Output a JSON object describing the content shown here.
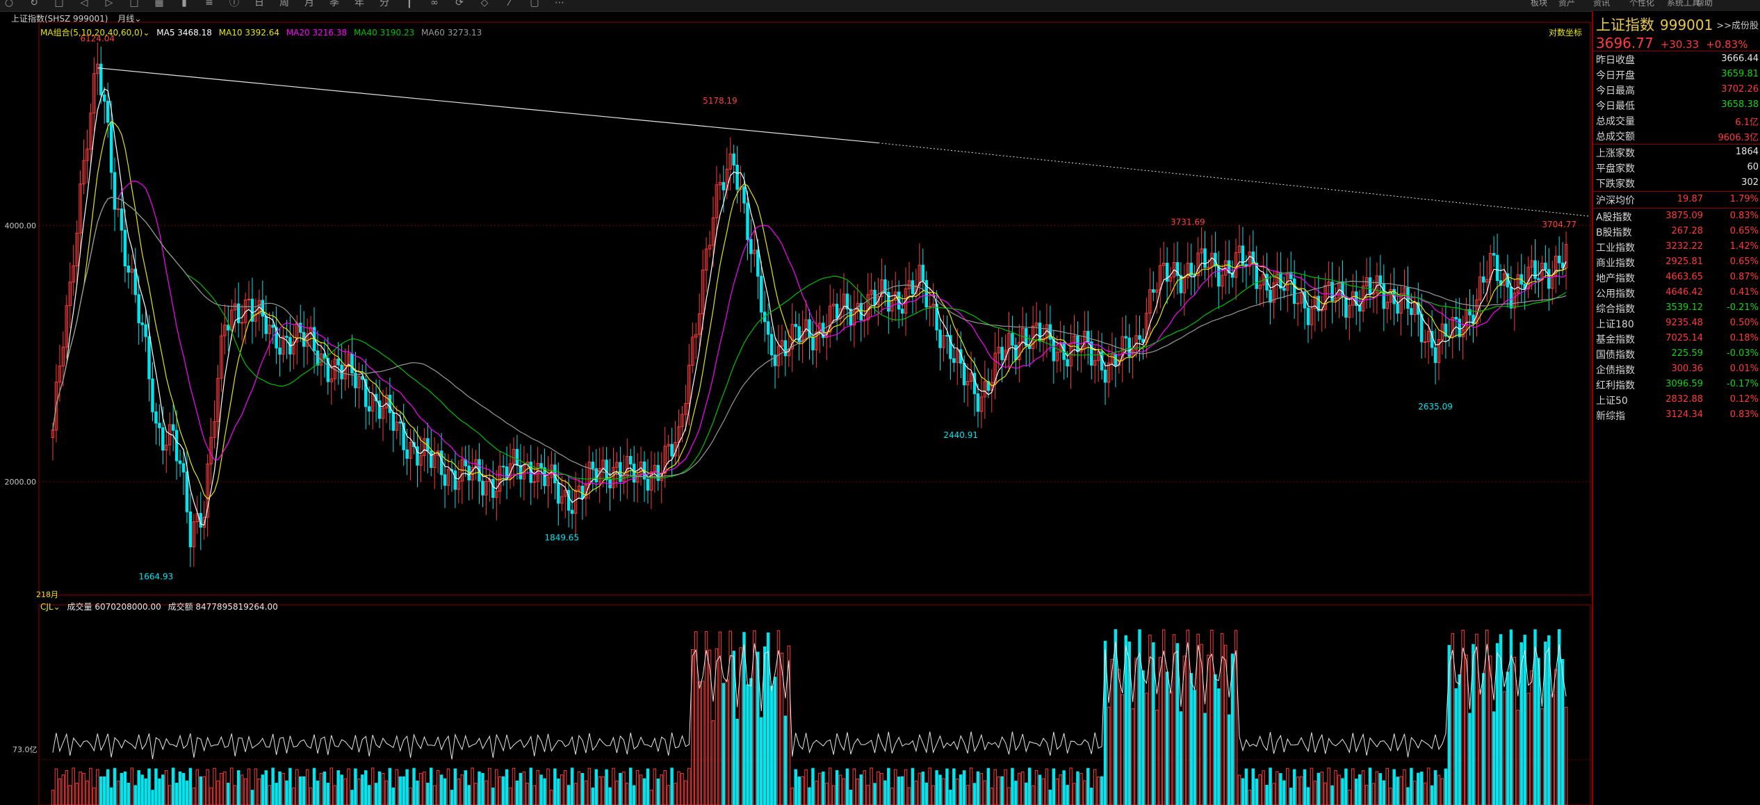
{
  "toolbar": {
    "icons": [
      "circle-icon",
      "refresh-icon",
      "square-icon",
      "back-icon",
      "forward-icon",
      "square-icon",
      "grid-icon",
      "bar-icon",
      "list-icon",
      "info-icon",
      "day-icon",
      "week-icon",
      "month-icon",
      "quarter-icon",
      "year-icon",
      "minute-icon",
      "candle-icon",
      "link-icon",
      "loop-icon",
      "diamond-icon",
      "draw-icon",
      "lock-icon",
      "more-icon"
    ],
    "right_menu": [
      "板块",
      "资产",
      "资讯",
      "个性化",
      "系统工具",
      "帮助"
    ]
  },
  "chart_header": {
    "index_name": "上证指数(SHSZ 999001)",
    "period": "月线",
    "ma_label": "MA组合(5,10,20,40,60,0)",
    "ma5": "MA5 3468.18",
    "ma10": "MA10 3392.64",
    "ma20": "MA20 3216.38",
    "ma40": "MA40 3190.23",
    "ma60": "MA60 3273.13",
    "log_scale": "对数坐标",
    "start_label": "218月"
  },
  "volume_header": {
    "label": "CJL",
    "volume": "成交量 6070208000.00",
    "amount": "成交额 8477895819264.00",
    "axis_label": "73.0亿"
  },
  "chart_data": {
    "type": "candlestick",
    "y_ticks": [
      "4000.00",
      "2000.00"
    ],
    "annotations": [
      {
        "text": "6124.04",
        "kind": "high"
      },
      {
        "text": "1664.93",
        "kind": "low"
      },
      {
        "text": "5178.19",
        "kind": "high"
      },
      {
        "text": "1849.65",
        "kind": "low"
      },
      {
        "text": "2440.91",
        "kind": "low"
      },
      {
        "text": "3731.69",
        "kind": "high"
      },
      {
        "text": "2635.09",
        "kind": "low"
      },
      {
        "text": "3704.77",
        "kind": "high"
      }
    ],
    "price_anchors": [
      [
        0,
        2300
      ],
      [
        5,
        3300
      ],
      [
        10,
        5200
      ],
      [
        13,
        6124
      ],
      [
        18,
        4300
      ],
      [
        24,
        3300
      ],
      [
        30,
        2300
      ],
      [
        35,
        2300
      ],
      [
        40,
        1700
      ],
      [
        44,
        1900
      ],
      [
        50,
        3000
      ],
      [
        57,
        3300
      ],
      [
        64,
        2900
      ],
      [
        70,
        3000
      ],
      [
        78,
        2800
      ],
      [
        90,
        2600
      ],
      [
        100,
        2300
      ],
      [
        110,
        2100
      ],
      [
        118,
        2050
      ],
      [
        126,
        2000
      ],
      [
        132,
        2050
      ],
      [
        140,
        2100
      ],
      [
        148,
        1900
      ],
      [
        156,
        2000
      ],
      [
        164,
        2100
      ],
      [
        170,
        2000
      ],
      [
        176,
        2100
      ],
      [
        182,
        2200
      ],
      [
        188,
        3300
      ],
      [
        194,
        4400
      ],
      [
        198,
        4900
      ],
      [
        203,
        3700
      ],
      [
        208,
        2900
      ],
      [
        214,
        2900
      ],
      [
        220,
        3000
      ],
      [
        226,
        3100
      ],
      [
        232,
        3200
      ],
      [
        238,
        3250
      ],
      [
        245,
        3300
      ],
      [
        252,
        3400
      ],
      [
        258,
        3050
      ],
      [
        264,
        2650
      ],
      [
        270,
        2550
      ],
      [
        276,
        2800
      ],
      [
        282,
        3000
      ],
      [
        290,
        2900
      ],
      [
        300,
        2850
      ],
      [
        308,
        2750
      ],
      [
        315,
        2900
      ],
      [
        320,
        3400
      ],
      [
        326,
        3500
      ],
      [
        332,
        3600
      ],
      [
        338,
        3550
      ],
      [
        344,
        3650
      ],
      [
        350,
        3500
      ],
      [
        356,
        3400
      ],
      [
        362,
        3300
      ],
      [
        368,
        3200
      ],
      [
        374,
        3350
      ],
      [
        380,
        3250
      ],
      [
        386,
        3400
      ],
      [
        392,
        3250
      ],
      [
        398,
        3050
      ],
      [
        402,
        2900
      ],
      [
        408,
        3000
      ],
      [
        414,
        3300
      ],
      [
        418,
        3550
      ],
      [
        424,
        3400
      ],
      [
        430,
        3450
      ],
      [
        436,
        3600
      ],
      [
        440,
        3700
      ]
    ],
    "volume_line_label": "成交额"
  },
  "sidebar": {
    "name": "上证指数",
    "code": "999001",
    "link": ">>成份股",
    "last": "3696.77",
    "change": "+30.33",
    "pct": "+0.83%",
    "quote_rows": [
      {
        "label": "昨日收盘",
        "value": "3666.44",
        "color": "white"
      },
      {
        "label": "今日开盘",
        "value": "3659.81",
        "color": "green"
      },
      {
        "label": "今日最高",
        "value": "3702.26",
        "color": "red"
      },
      {
        "label": "今日最低",
        "value": "3658.38",
        "color": "green"
      },
      {
        "label": "总成交量",
        "value": "6.1亿",
        "color": "red"
      },
      {
        "label": "总成交额",
        "value": "9606.3亿",
        "color": "red"
      }
    ],
    "breadth_rows": [
      {
        "label": "上涨家数",
        "value": "1864"
      },
      {
        "label": "平盘家数",
        "value": "60"
      },
      {
        "label": "下跌家数",
        "value": "302"
      }
    ],
    "hushen": {
      "label": "沪深均价",
      "v1": "19.87",
      "v2": "1.79%"
    },
    "index_rows": [
      {
        "label": "A股指数",
        "v1": "3875.09",
        "v2": "0.83%",
        "color": "red"
      },
      {
        "label": "B股指数",
        "v1": "267.28",
        "v2": "0.65%",
        "color": "red"
      },
      {
        "label": "工业指数",
        "v1": "3232.22",
        "v2": "1.42%",
        "color": "red"
      },
      {
        "label": "商业指数",
        "v1": "2925.81",
        "v2": "0.65%",
        "color": "red"
      },
      {
        "label": "地产指数",
        "v1": "4663.65",
        "v2": "0.87%",
        "color": "red"
      },
      {
        "label": "公用指数",
        "v1": "4646.42",
        "v2": "0.41%",
        "color": "red"
      },
      {
        "label": "综合指数",
        "v1": "3539.12",
        "v2": "-0.21%",
        "color": "green"
      },
      {
        "label": "上证180",
        "v1": "9235.48",
        "v2": "0.50%",
        "color": "red"
      },
      {
        "label": "基金指数",
        "v1": "7025.14",
        "v2": "0.18%",
        "color": "red"
      },
      {
        "label": "国债指数",
        "v1": "225.59",
        "v2": "-0.03%",
        "color": "green"
      },
      {
        "label": "企债指数",
        "v1": "300.36",
        "v2": "0.01%",
        "color": "red"
      },
      {
        "label": "红利指数",
        "v1": "3096.59",
        "v2": "-0.17%",
        "color": "green"
      },
      {
        "label": "上证50",
        "v1": "2832.88",
        "v2": "0.12%",
        "color": "red"
      },
      {
        "label": "新综指",
        "v1": "3124.34",
        "v2": "0.83%",
        "color": "red"
      }
    ]
  },
  "colors": {
    "up": "#ff3b3b",
    "down": "#00e5ee",
    "ma5": "#ffffff",
    "ma10": "#e6e600",
    "ma20": "#ff00ff",
    "ma40": "#00c000",
    "ma60": "#9a9a9a",
    "border": "#8b0000",
    "annot_high": "#ff4040",
    "annot_low": "#00e5ee"
  }
}
